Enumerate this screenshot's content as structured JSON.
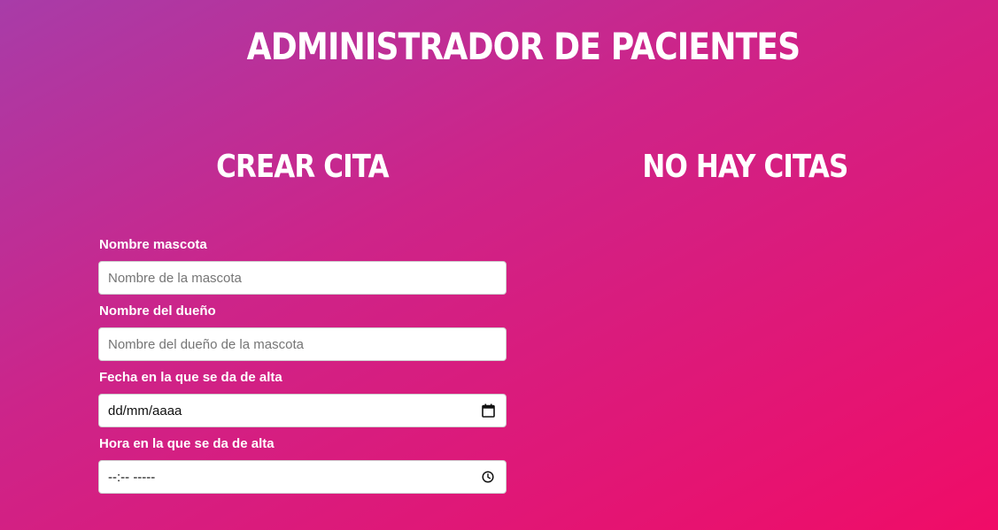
{
  "header": {
    "title": "Administrador de pacientes"
  },
  "left_column": {
    "title": "Crear cita"
  },
  "right_column": {
    "title": "No hay citas"
  },
  "form": {
    "pet_name": {
      "label": "Nombre mascota",
      "placeholder": "Nombre de la mascota"
    },
    "owner_name": {
      "label": "Nombre del dueño",
      "placeholder": "Nombre del dueño de la mascota"
    },
    "date": {
      "label": "Fecha en la que se da de alta",
      "mask": "dd/mm/aaaa",
      "icon": "calendar-icon"
    },
    "time": {
      "label": "Hora en la que se da de alta",
      "mask": "--:-- -----",
      "icon": "clock-icon"
    }
  },
  "colors": {
    "gradient_start": "#a83ca8",
    "gradient_mid": "#cd2489",
    "gradient_end": "#f00c67",
    "text": "#ffffff",
    "input_bg": "#ffffff"
  }
}
